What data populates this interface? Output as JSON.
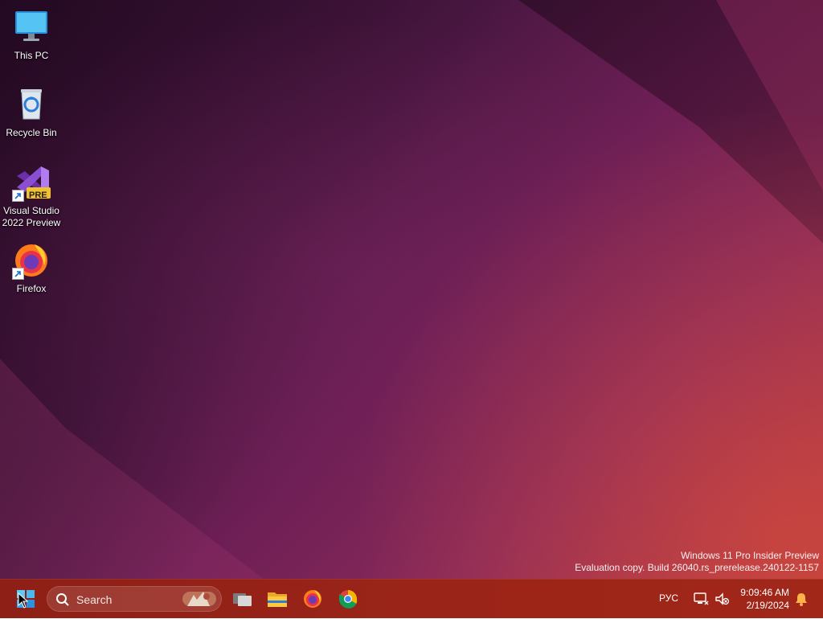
{
  "desktop": {
    "icons": [
      {
        "label_line1": "This PC",
        "label_line2": "",
        "icon": "monitor-icon"
      },
      {
        "label_line1": "Recycle Bin",
        "label_line2": "",
        "icon": "recycle-bin-icon"
      },
      {
        "label_line1": "Visual Studio",
        "label_line2": "2022 Preview",
        "icon": "visual-studio-preview-icon",
        "badge": "PRE"
      },
      {
        "label_line1": "Firefox",
        "label_line2": "",
        "icon": "firefox-icon"
      }
    ],
    "watermark": {
      "line1": "Windows 11 Pro Insider Preview",
      "line2": "Evaluation copy. Build 26040.rs_prerelease.240122-1157"
    }
  },
  "taskbar": {
    "search_label": "Search",
    "apps": [
      "start-icon",
      "task-view-icon",
      "file-explorer-icon",
      "firefox-icon",
      "chrome-icon"
    ],
    "tray": {
      "language": "РУС",
      "time": "9:09:46 AM",
      "date": "2/19/2024"
    }
  },
  "colors": {
    "taskbar": "#9a2418",
    "wallpaper_dark": "#2f0e2d",
    "wallpaper_accent": "#b0393f"
  }
}
